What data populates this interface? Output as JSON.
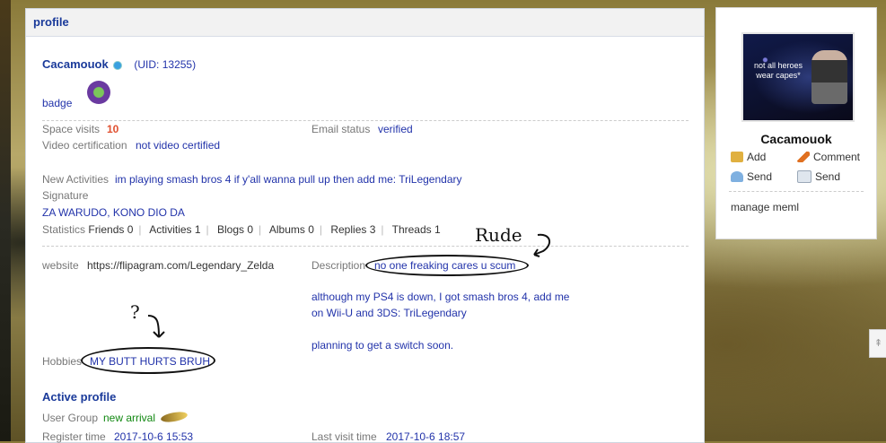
{
  "panel": {
    "title": "profile"
  },
  "user": {
    "name": "Cacamouok",
    "uid": "(UID: 13255)",
    "badge_label": "badge"
  },
  "stats_block": {
    "space_visits_label": "Space visits",
    "space_visits_value": "10",
    "email_label": "Email status",
    "email_value": "verified",
    "video_label": "Video certification",
    "video_value": "not video certified"
  },
  "activities": {
    "label": "New Activities",
    "value": "im playing smash bros 4 if y'all wanna pull up then add me: TriLegendary"
  },
  "signature": {
    "label": "Signature",
    "value": "ZA WARUDO, KONO DIO DA"
  },
  "statistics": {
    "label": "Statistics",
    "items": [
      "Friends 0",
      "Activities 1",
      "Blogs 0",
      "Albums 0",
      "Replies 3",
      "Threads 1"
    ]
  },
  "details": {
    "website_label": "website",
    "website_value": "https://flipagram.com/Legendary_Zelda",
    "description_label": "Description",
    "description_line1": "no one freaking cares u scum",
    "description_line2": "although my PS4 is down, I got smash bros 4, add me",
    "description_line3": "on Wii-U and 3DS: TriLegendary",
    "description_line4": "planning to get a switch soon.",
    "hobbies_label": "Hobbies",
    "hobbies_value": "MY BUTT HURTS BRUH"
  },
  "annotations": {
    "rude": "Rude",
    "question": "?"
  },
  "active_profile": {
    "title": "Active profile",
    "group_label": "User Group",
    "group_value": "new arrival",
    "register_label": "Register time",
    "register_value": "2017-10-6 15:53",
    "last_visit_label": "Last visit time",
    "last_visit_value": "2017-10-6 18:57"
  },
  "sidebar": {
    "avatar_caption": "not all heroes wear capes*",
    "name": "Cacamouok",
    "actions": [
      {
        "label": "Add",
        "icon": "handshake-icon"
      },
      {
        "label": "Comment",
        "icon": "pencil-icon"
      },
      {
        "label": "Send",
        "icon": "user-send-icon"
      },
      {
        "label": "Send",
        "icon": "mail-icon"
      }
    ],
    "manage": "manage meml"
  },
  "colors": {
    "link": "#2233aa",
    "accent_visits": "#e05030",
    "online_dot": "#3aa0e0"
  }
}
